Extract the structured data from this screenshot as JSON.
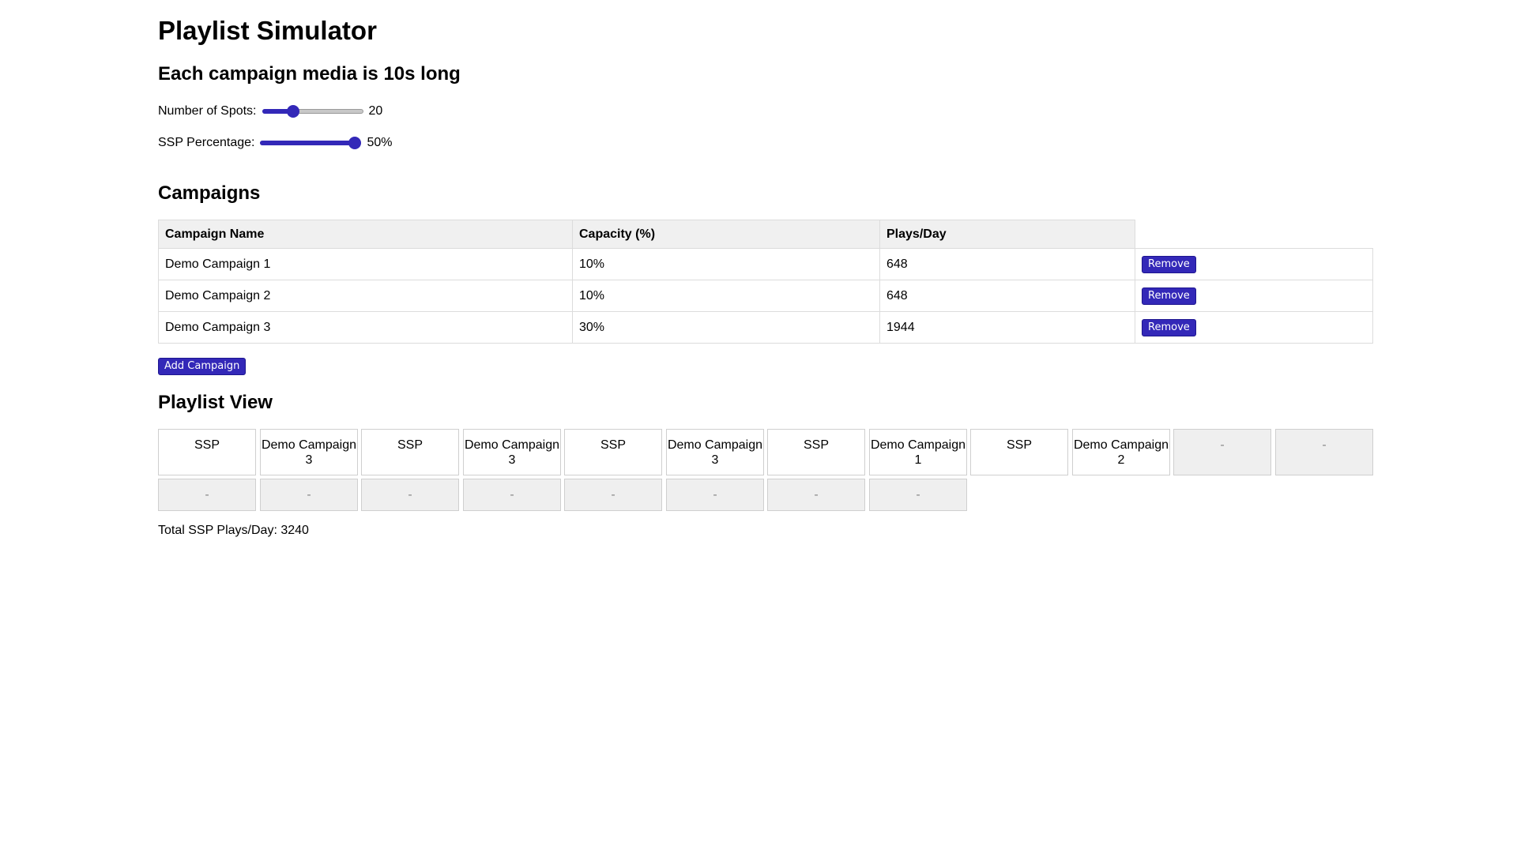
{
  "title": "Playlist Simulator",
  "subtitle": "Each campaign media is 10s long",
  "controls": {
    "spots_label": "Number of Spots:",
    "spots_value": "20",
    "spots_fraction": 0.28,
    "ssp_label": "SSP Percentage:",
    "ssp_value": "50%",
    "ssp_fraction": 1.0,
    "accent_color": "#3328b8"
  },
  "campaigns": {
    "heading": "Campaigns",
    "columns": [
      "Campaign Name",
      "Capacity (%)",
      "Plays/Day"
    ],
    "rows": [
      {
        "name": "Demo Campaign 1",
        "capacity": "10%",
        "plays": "648",
        "action": "Remove"
      },
      {
        "name": "Demo Campaign 2",
        "capacity": "10%",
        "plays": "648",
        "action": "Remove"
      },
      {
        "name": "Demo Campaign 3",
        "capacity": "30%",
        "plays": "1944",
        "action": "Remove"
      }
    ],
    "add_label": "Add Campaign"
  },
  "playlist": {
    "heading": "Playlist View",
    "row1": [
      "SSP",
      "Demo Campaign 3",
      "SSP",
      "Demo Campaign 3",
      "SSP",
      "Demo Campaign 3",
      "SSP",
      "Demo Campaign 1",
      "SSP",
      "Demo Campaign 2",
      "-",
      "-"
    ],
    "row2": [
      "-",
      "-",
      "-",
      "-",
      "-",
      "-",
      "-",
      "-"
    ],
    "total_text": "Total SSP Plays/Day: 3240"
  }
}
